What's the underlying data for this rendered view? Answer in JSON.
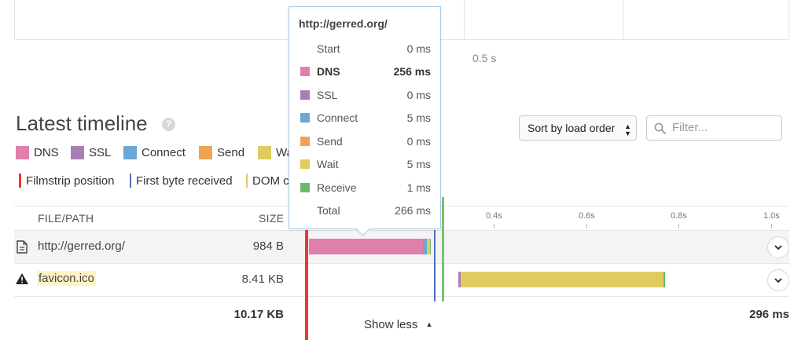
{
  "filmstrip": {
    "time_label": "0.5 s"
  },
  "heading": {
    "title": "Latest timeline",
    "help_icon": "question-icon"
  },
  "legend": {
    "phases": [
      {
        "label": "DNS",
        "color": "#e07eac"
      },
      {
        "label": "SSL",
        "color": "#a97eb6"
      },
      {
        "label": "Connect",
        "color": "#6aa6d6"
      },
      {
        "label": "Send",
        "color": "#f0a352"
      },
      {
        "label": "Wait",
        "color": "#dfcc61"
      }
    ],
    "markers": [
      {
        "label": "Filmstrip position",
        "color": "#e63a2e"
      },
      {
        "label": "First byte received",
        "color": "#4a6fc1"
      },
      {
        "label": "DOM content loaded",
        "color": "#e8c36a"
      }
    ]
  },
  "controls": {
    "sort_label": "Sort by load order",
    "filter_placeholder": "Filter..."
  },
  "table": {
    "col_file": "FILE/PATH",
    "col_size": "SIZE",
    "ticks": [
      "0.4s",
      "0.6s",
      "0.8s",
      "1.0s"
    ],
    "rows": [
      {
        "file": "http://gerred.org/",
        "size": "984 B",
        "icon": "document-icon"
      },
      {
        "file": "favicon.ico",
        "size": "8.41 KB",
        "icon": "warning-icon"
      }
    ],
    "total_size": "10.17 KB",
    "total_time": "296 ms",
    "show_less": "Show less"
  },
  "tooltip": {
    "title": "http://gerred.org/",
    "rows": [
      {
        "label": "Start",
        "value": "0 ms",
        "color": ""
      },
      {
        "label": "DNS",
        "value": "256 ms",
        "color": "#e07eac"
      },
      {
        "label": "SSL",
        "value": "0 ms",
        "color": "#a97eb6"
      },
      {
        "label": "Connect",
        "value": "5 ms",
        "color": "#6aa6d6"
      },
      {
        "label": "Send",
        "value": "0 ms",
        "color": "#f0a352"
      },
      {
        "label": "Wait",
        "value": "5 ms",
        "color": "#dfcc61"
      },
      {
        "label": "Receive",
        "value": "1 ms",
        "color": "#6db96a"
      },
      {
        "label": "Total",
        "value": "266 ms",
        "color": ""
      }
    ]
  }
}
